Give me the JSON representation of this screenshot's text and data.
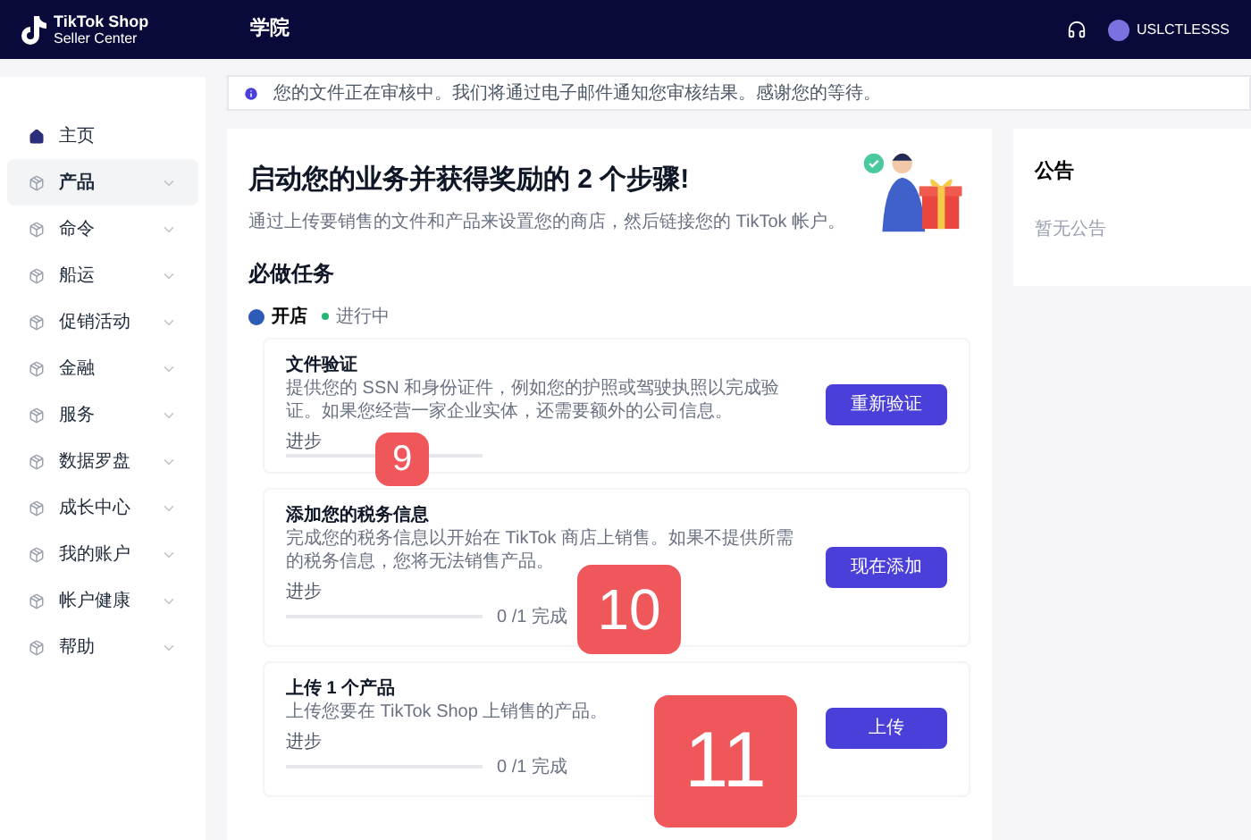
{
  "header": {
    "logo_line_1": "TikTok Shop",
    "logo_line_2": "Seller Center",
    "nav": "学院",
    "user": "USLCTLESSS"
  },
  "sidebar": {
    "items": [
      {
        "label": "主页",
        "selected": false,
        "expandable": false
      },
      {
        "label": "产品",
        "selected": true,
        "expandable": true
      },
      {
        "label": "命令",
        "selected": false,
        "expandable": true
      },
      {
        "label": "船运",
        "selected": false,
        "expandable": true
      },
      {
        "label": "促销活动",
        "selected": false,
        "expandable": true
      },
      {
        "label": "金融",
        "selected": false,
        "expandable": true
      },
      {
        "label": "服务",
        "selected": false,
        "expandable": true
      },
      {
        "label": "数据罗盘",
        "selected": false,
        "expandable": true
      },
      {
        "label": "成长中心",
        "selected": false,
        "expandable": true
      },
      {
        "label": "我的账户",
        "selected": false,
        "expandable": true
      },
      {
        "label": "帐户健康",
        "selected": false,
        "expandable": true
      },
      {
        "label": "帮助",
        "selected": false,
        "expandable": true
      }
    ]
  },
  "alert": "您的文件正在审核中。我们将通过电子邮件通知您审核结果。感谢您的等待。",
  "main": {
    "title": "启动您的业务并获得奖励的 2 个步骤!",
    "subtitle": "通过上传要销售的文件和产品来设置您的商店，然后链接您的 TikTok 帐户。",
    "section": "必做任务",
    "stage": {
      "label": "开店",
      "status": "进行中"
    },
    "tasks": [
      {
        "title": "文件验证",
        "description": "提供您的 SSN 和身份证件，例如您的护照或驾驶执照以完成验证。如果您经营一家企业实体，还需要额外的公司信息。",
        "progress_label": "进步",
        "level": 0,
        "button": "重新验证"
      },
      {
        "title": "添加您的税务信息",
        "description": "完成您的税务信息以开始在 TikTok 商店上销售。如果不提供所需的税务信息，您将无法销售产品。",
        "progress_label": "进步",
        "level": 0,
        "reading": "0 /1 完成",
        "button": "现在添加"
      },
      {
        "title": "上传 1 个产品",
        "description": "上传您要在 TikTok Shop 上销售的产品。",
        "progress_label": "进步",
        "level": 0,
        "reading": "0 /1 完成",
        "button": "上传"
      }
    ]
  },
  "callouts": [
    "9",
    "10",
    "11"
  ],
  "notice": {
    "title": "公告",
    "empty": "暂无公告"
  }
}
